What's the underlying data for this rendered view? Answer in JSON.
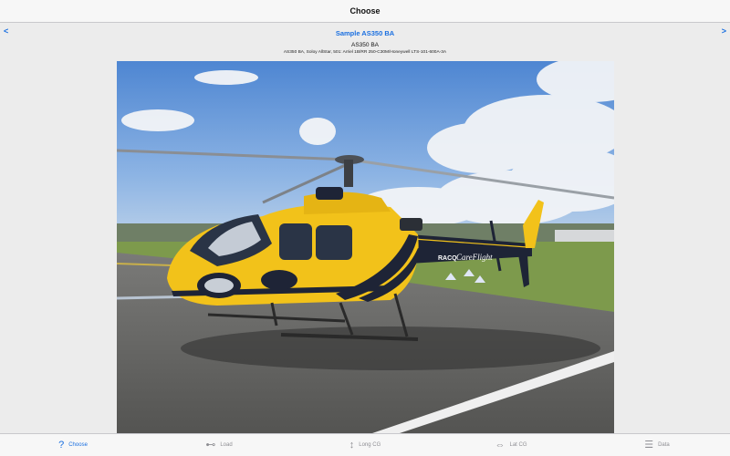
{
  "nav": {
    "title": "Choose"
  },
  "header": {
    "prev_arrow": "<",
    "next_arrow": ">",
    "sample_title": "Sample AS350 BA",
    "model": "AS350 BA",
    "description": "AS350 BA, Soloy AllStar, 501: Arriel 1B/RR 250-C30M/Honeywell LTS-101-600A-3A"
  },
  "photo": {
    "livery_text": "CareFlight",
    "badge_text": "RACQ"
  },
  "tabs": [
    {
      "label": "Choose",
      "icon": "?",
      "active": true
    },
    {
      "label": "Load",
      "icon": "⊷",
      "active": false
    },
    {
      "label": "Long CG",
      "icon": "↕",
      "active": false
    },
    {
      "label": "Lat CG",
      "icon": "⇔",
      "active": false
    },
    {
      "label": "Data",
      "icon": "☰",
      "active": false
    }
  ],
  "colors": {
    "accent": "#1a6fe0",
    "inactive": "#8e8e93",
    "helicopter_yellow": "#f2c21a",
    "helicopter_navy": "#1e2436"
  }
}
